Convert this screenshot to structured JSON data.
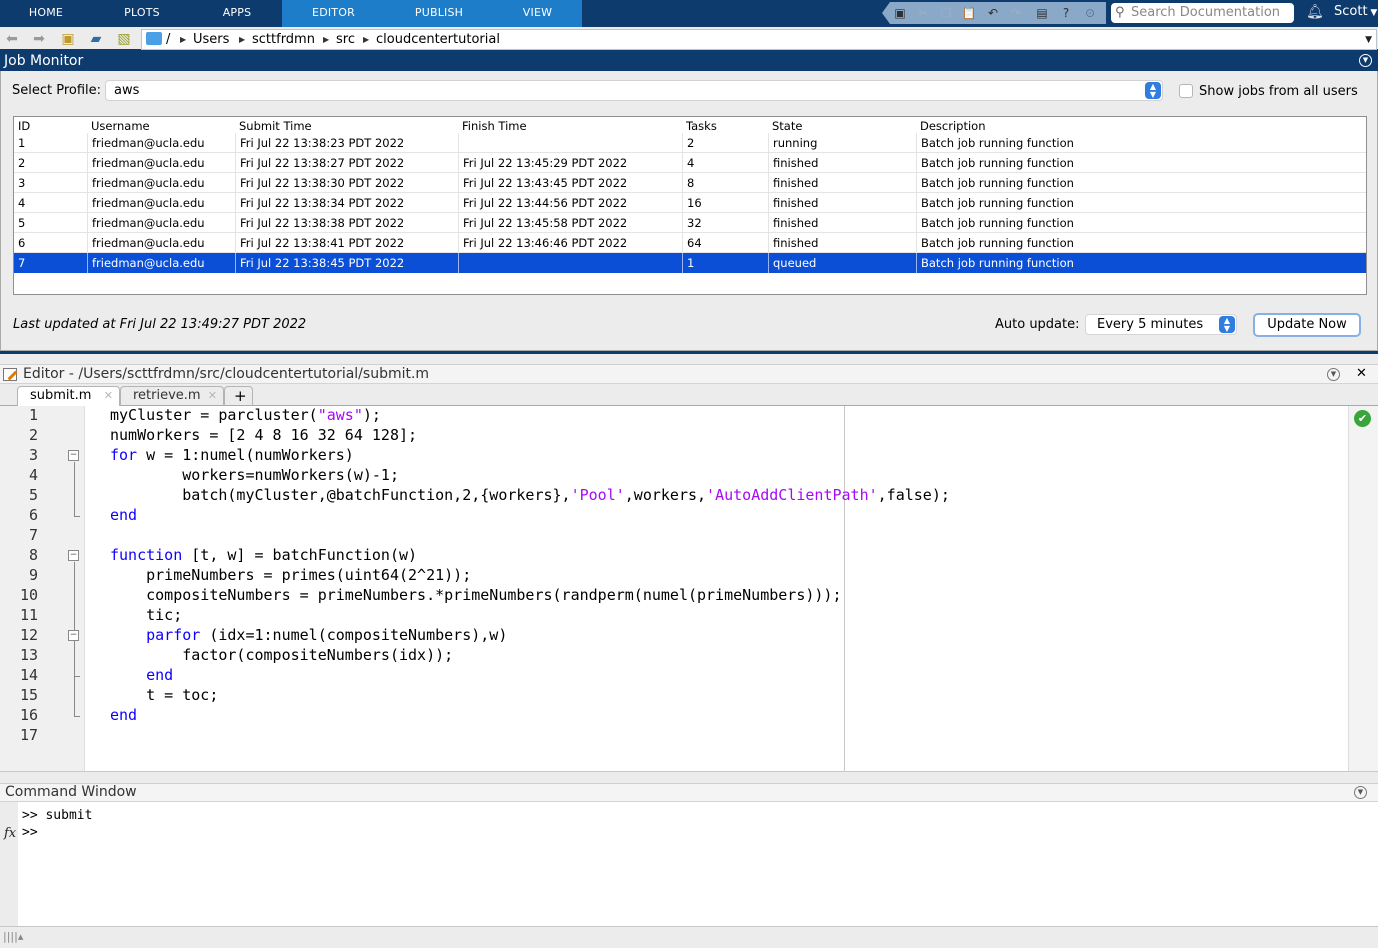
{
  "ribbon": {
    "tabs": [
      {
        "label": "HOME",
        "active": false
      },
      {
        "label": "PLOTS",
        "active": false
      },
      {
        "label": "APPS",
        "active": false
      },
      {
        "label": "EDITOR",
        "active": true
      },
      {
        "label": "PUBLISH",
        "active": true
      },
      {
        "label": "VIEW",
        "active": true
      }
    ],
    "quick_access": [
      "save-icon",
      "cut-icon",
      "copy-icon",
      "paste-icon",
      "undo-icon",
      "redo-icon",
      "switch-windows-icon",
      "help-icon",
      "access-menu-icon"
    ],
    "search_placeholder": "Search Documentation",
    "user": "Scott"
  },
  "path_bar": {
    "crumbs": [
      "/",
      "Users",
      "scttfrdmn",
      "src",
      "cloudcentertutorial"
    ]
  },
  "job_monitor": {
    "title": "Job Monitor",
    "profile_label": "Select Profile:",
    "profile_value": "aws",
    "show_all_label": "Show jobs from all users",
    "show_all_checked": false,
    "columns": [
      "ID",
      "Username",
      "Submit Time",
      "Finish Time",
      "Tasks",
      "State",
      "Description"
    ],
    "rows": [
      {
        "id": "1",
        "username": "friedman@ucla.edu",
        "submit": "Fri Jul 22 13:38:23 PDT 2022",
        "finish": "",
        "tasks": "2",
        "state": "running",
        "description": "Batch job running function"
      },
      {
        "id": "2",
        "username": "friedman@ucla.edu",
        "submit": "Fri Jul 22 13:38:27 PDT 2022",
        "finish": "Fri Jul 22 13:45:29 PDT 2022",
        "tasks": "4",
        "state": "finished",
        "description": "Batch job running function"
      },
      {
        "id": "3",
        "username": "friedman@ucla.edu",
        "submit": "Fri Jul 22 13:38:30 PDT 2022",
        "finish": "Fri Jul 22 13:43:45 PDT 2022",
        "tasks": "8",
        "state": "finished",
        "description": "Batch job running function"
      },
      {
        "id": "4",
        "username": "friedman@ucla.edu",
        "submit": "Fri Jul 22 13:38:34 PDT 2022",
        "finish": "Fri Jul 22 13:44:56 PDT 2022",
        "tasks": "16",
        "state": "finished",
        "description": "Batch job running function"
      },
      {
        "id": "5",
        "username": "friedman@ucla.edu",
        "submit": "Fri Jul 22 13:38:38 PDT 2022",
        "finish": "Fri Jul 22 13:45:58 PDT 2022",
        "tasks": "32",
        "state": "finished",
        "description": "Batch job running function"
      },
      {
        "id": "6",
        "username": "friedman@ucla.edu",
        "submit": "Fri Jul 22 13:38:41 PDT 2022",
        "finish": "Fri Jul 22 13:46:46 PDT 2022",
        "tasks": "64",
        "state": "finished",
        "description": "Batch job running function"
      },
      {
        "id": "7",
        "username": "friedman@ucla.edu",
        "submit": "Fri Jul 22 13:38:45 PDT 2022",
        "finish": "",
        "tasks": "1",
        "state": "queued",
        "description": "Batch job running function",
        "selected": true
      }
    ],
    "last_updated": "Last updated at Fri Jul 22 13:49:27 PDT 2022",
    "auto_update_label": "Auto update:",
    "auto_update_value": "Every 5 minutes",
    "update_now_label": "Update Now"
  },
  "editor": {
    "title": "Editor - /Users/scttfrdmn/src/cloudcentertutorial/submit.m",
    "tabs": [
      {
        "label": "submit.m",
        "active": true
      },
      {
        "label": "retrieve.m",
        "active": false
      }
    ],
    "add_tab_label": "+",
    "lines": [
      "myCluster = parcluster(\"aws\");",
      "numWorkers = [2 4 8 16 32 64 128];",
      "for w = 1:numel(numWorkers)",
      "        workers=numWorkers(w)-1;",
      "        batch(myCluster,@batchFunction,2,{workers},'Pool',workers,'AutoAddClientPath',false);",
      "end",
      "",
      "function [t, w] = batchFunction(w)",
      "    primeNumbers = primes(uint64(2^21));",
      "    compositeNumbers = primeNumbers.*primeNumbers(randperm(numel(primeNumbers)));",
      "    tic;",
      "    parfor (idx=1:numel(compositeNumbers),w)",
      "        factor(compositeNumbers(idx));",
      "    end",
      "    t = toc;",
      "end",
      ""
    ],
    "status": "no-issues"
  },
  "command_window": {
    "title": "Command Window",
    "lines": [
      ">> submit",
      ">> "
    ]
  },
  "colors": {
    "ribbon_dark": "#0d3b6e",
    "ribbon_active": "#1e7dc8",
    "selection": "#0b4fd6",
    "keyword": "#0e00ff",
    "string": "#a709f5"
  }
}
